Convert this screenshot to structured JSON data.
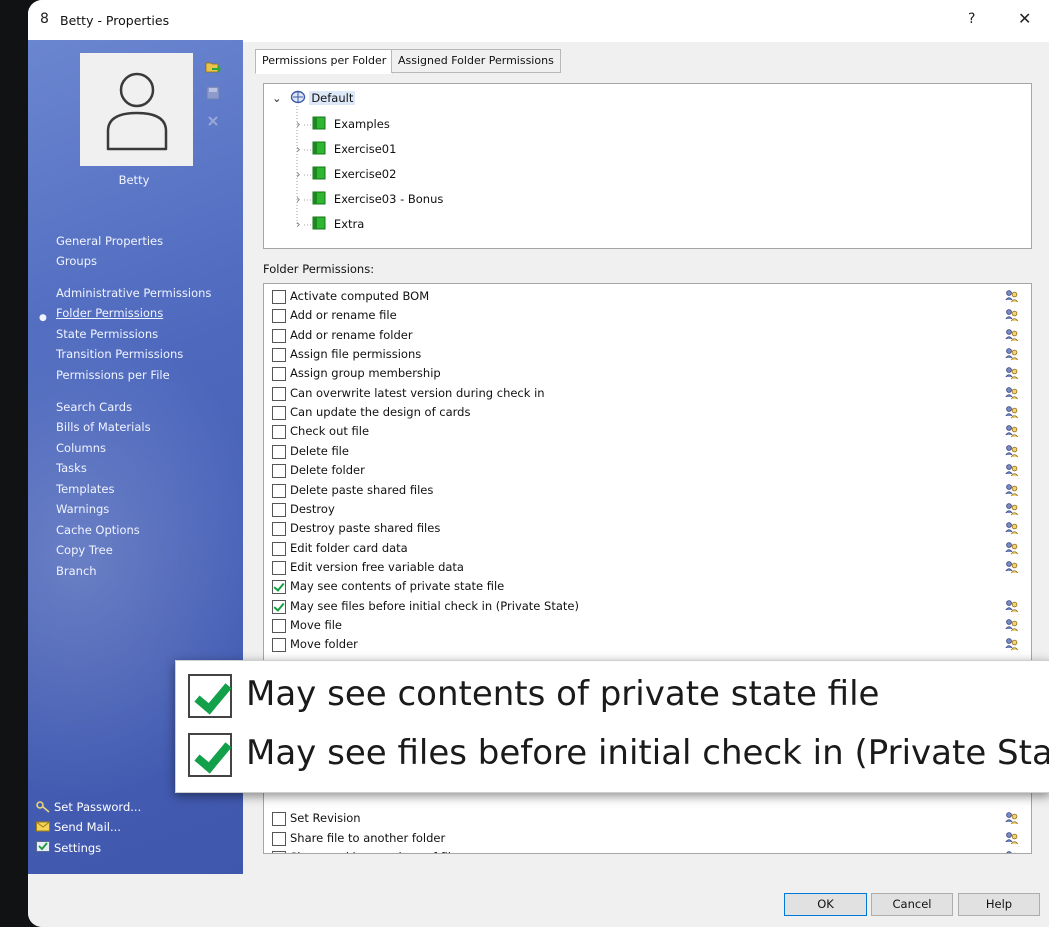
{
  "window": {
    "title": "Betty - Properties",
    "help_label": "?",
    "close_label": "✕"
  },
  "sidebar": {
    "user_name": "Betty",
    "nav_groups": [
      [
        "General Properties",
        "Groups"
      ],
      [
        "Administrative Permissions",
        "Folder Permissions",
        "State Permissions",
        "Transition Permissions",
        "Permissions per File"
      ],
      [
        "Search Cards",
        "Bills of Materials",
        "Columns",
        "Tasks",
        "Templates",
        "Warnings",
        "Cache Options",
        "Copy Tree",
        "Branch"
      ]
    ],
    "active_item": "Folder Permissions",
    "bottom_links": [
      "Set Password...",
      "Send Mail...",
      "Settings"
    ]
  },
  "tabs": [
    "Permissions per Folder",
    "Assigned Folder Permissions"
  ],
  "tree": {
    "root": "Default",
    "children": [
      "Examples",
      "Exercise01",
      "Exercise02",
      "Exercise03 - Bonus",
      "Extra"
    ]
  },
  "folder_permissions_label": "Folder Permissions:",
  "permissions": [
    {
      "label": "Activate computed BOM",
      "checked": false
    },
    {
      "label": "Add or rename file",
      "checked": false
    },
    {
      "label": "Add or rename folder",
      "checked": false
    },
    {
      "label": "Assign file permissions",
      "checked": false
    },
    {
      "label": "Assign group membership",
      "checked": false
    },
    {
      "label": "Can overwrite latest version during check in",
      "checked": false
    },
    {
      "label": "Can update the design of cards",
      "checked": false
    },
    {
      "label": "Check out file",
      "checked": false
    },
    {
      "label": "Delete file",
      "checked": false
    },
    {
      "label": "Delete folder",
      "checked": false
    },
    {
      "label": "Delete paste shared files",
      "checked": false
    },
    {
      "label": "Destroy",
      "checked": false
    },
    {
      "label": "Destroy paste shared files",
      "checked": false
    },
    {
      "label": "Edit folder card data",
      "checked": false
    },
    {
      "label": "Edit version free variable data",
      "checked": false
    },
    {
      "label": "May see contents of private state file",
      "checked": true
    },
    {
      "label": "May see files before initial check in (Private State)",
      "checked": true
    },
    {
      "label": "Move file",
      "checked": false
    },
    {
      "label": "Move folder",
      "checked": false
    },
    {
      "label": "Set Revision",
      "checked": false
    },
    {
      "label": "Share file to another folder",
      "checked": false
    },
    {
      "label": "Show working versions of files",
      "checked": false
    }
  ],
  "zoom_callout": [
    "May see contents of private state file",
    "May see files before initial check in (Private Sta"
  ],
  "buttons": {
    "ok": "OK",
    "cancel": "Cancel",
    "help": "Help"
  },
  "colors": {
    "sidebar": "#4d68bd",
    "checkmark": "#10a040",
    "folder_icon": "#2fb52f",
    "default_button_border": "#0078d7"
  }
}
